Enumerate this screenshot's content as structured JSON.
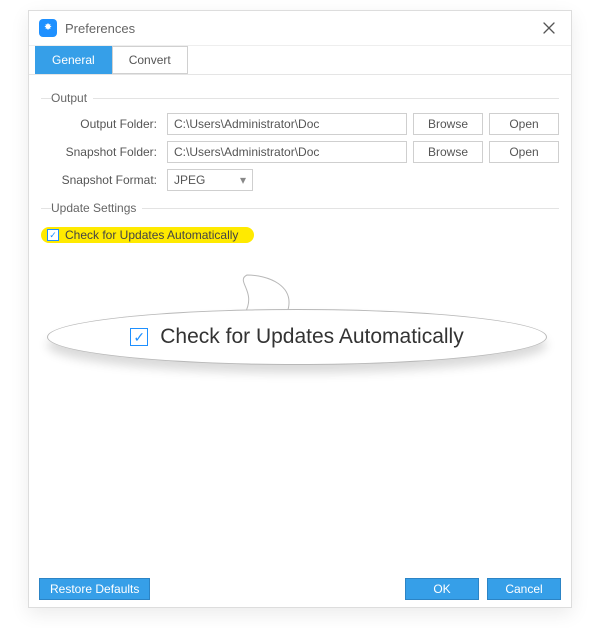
{
  "window": {
    "title": "Preferences"
  },
  "tabs": {
    "general": "General",
    "convert": "Convert"
  },
  "output": {
    "legend": "Output",
    "folder_label": "Output Folder:",
    "folder_value": "C:\\Users\\Administrator\\Doc",
    "snapshot_folder_label": "Snapshot Folder:",
    "snapshot_folder_value": "C:\\Users\\Administrator\\Doc",
    "snapshot_format_label": "Snapshot Format:",
    "snapshot_format_value": "JPEG",
    "browse": "Browse",
    "open": "Open"
  },
  "update": {
    "legend": "Update Settings",
    "auto_check_label": "Check for Updates Automatically",
    "checked": true
  },
  "callout": {
    "label": "Check for Updates Automatically"
  },
  "footer": {
    "restore": "Restore Defaults",
    "ok": "OK",
    "cancel": "Cancel"
  }
}
